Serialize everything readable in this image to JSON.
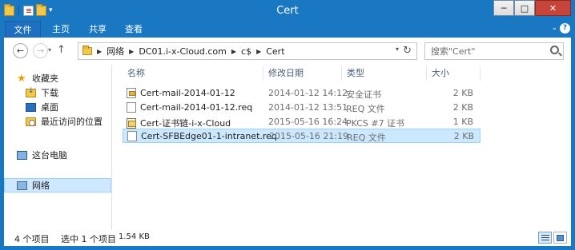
{
  "window": {
    "title": "Cert",
    "controls": {
      "minimize": "─",
      "maximize": "□",
      "close": "✕"
    },
    "qat_dropdown": "▾"
  },
  "ribbon": {
    "tabs": [
      "文件",
      "主页",
      "共享",
      "查看"
    ],
    "expand_glyph": "⌄",
    "help_glyph": "?"
  },
  "navigation": {
    "back_glyph": "←",
    "forward_glyph": "→",
    "recent_glyph": "▾",
    "up_glyph": "↑",
    "breadcrumbs": [
      "网络",
      "DC01.i-x-Cloud.com",
      "c$",
      "Cert"
    ],
    "crumb_separator": "▶",
    "address_dropdown": "▾",
    "refresh_glyph": "↻",
    "search_placeholder": "搜索\"Cert\""
  },
  "sidebar": {
    "favorites_label": "收藏夹",
    "favorites": [
      "下载",
      "桌面",
      "最近访问的位置"
    ],
    "this_pc_label": "这台电脑",
    "network_label": "网络"
  },
  "file_list": {
    "columns": [
      "名称",
      "修改日期",
      "类型",
      "大小"
    ],
    "files": [
      {
        "name": "Cert-mail-2014-01-12",
        "date": "2014-01-12 14:12",
        "type": "安全证书",
        "size": "2 KB",
        "icon": "certificate-icon"
      },
      {
        "name": "Cert-mail-2014-01-12.req",
        "date": "2014-01-12 13:51",
        "type": "REQ 文件",
        "size": "2 KB",
        "icon": "file-icon"
      },
      {
        "name": "Cert-证书链-i-x-Cloud",
        "date": "2015-05-16 16:24",
        "type": "PKCS #7 证书",
        "size": "1 KB",
        "icon": "certificate-chain-icon"
      },
      {
        "name": "Cert-SFBEdge01-1-intranet.req",
        "date": "2015-05-16 21:19",
        "type": "REQ 文件",
        "size": "2 KB",
        "icon": "file-icon"
      }
    ],
    "selected_index": 3
  },
  "status_bar": {
    "item_count": "4 个项目",
    "selection": "选中 1 个项目",
    "selection_size": "1.54 KB"
  },
  "colors": {
    "title_bar": "#1a78c2",
    "selection": "#cce8ff",
    "selection_border": "#99d1ff"
  }
}
